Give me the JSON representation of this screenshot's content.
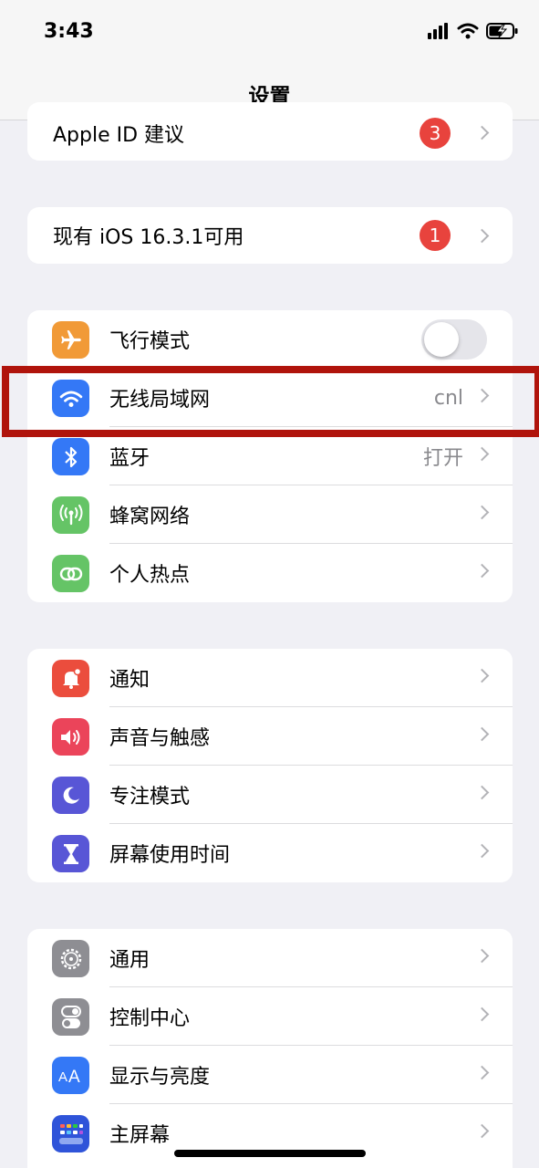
{
  "status_bar": {
    "time": "3:43"
  },
  "nav": {
    "title": "设置"
  },
  "groups": {
    "apple_id": {
      "label": "Apple ID 建议",
      "badge": "3"
    },
    "update": {
      "label": "现有 iOS 16.3.1可用",
      "badge": "1"
    },
    "connectivity": [
      {
        "label": "飞行模式",
        "icon": "airplane-icon",
        "color": "#f19a37",
        "toggle": false
      },
      {
        "label": "无线局域网",
        "value": "cnl",
        "icon": "wifi-icon",
        "color": "#3478f6"
      },
      {
        "label": "蓝牙",
        "value": "打开",
        "icon": "bluetooth-icon",
        "color": "#3478f6"
      },
      {
        "label": "蜂窝网络",
        "icon": "cellular-icon",
        "color": "#65c466"
      },
      {
        "label": "个人热点",
        "icon": "hotspot-icon",
        "color": "#65c466"
      }
    ],
    "notifications": [
      {
        "label": "通知",
        "icon": "notification-icon",
        "color": "#eb4d3d"
      },
      {
        "label": "声音与触感",
        "icon": "sound-icon",
        "color": "#eb445a"
      },
      {
        "label": "专注模式",
        "icon": "moon-icon",
        "color": "#5856d6"
      },
      {
        "label": "屏幕使用时间",
        "icon": "hourglass-icon",
        "color": "#5856d6"
      }
    ],
    "general": [
      {
        "label": "通用",
        "icon": "gear-icon",
        "color": "#8e8e93"
      },
      {
        "label": "控制中心",
        "icon": "control-center-icon",
        "color": "#8e8e93"
      },
      {
        "label": "显示与亮度",
        "icon": "display-icon",
        "color": "#3478f6"
      },
      {
        "label": "主屏幕",
        "icon": "home-screen-icon",
        "color": "#2f54d9"
      }
    ]
  }
}
